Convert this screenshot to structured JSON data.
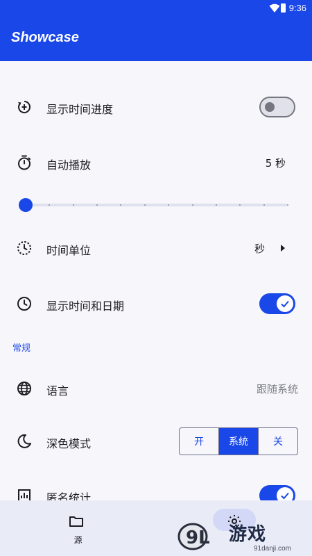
{
  "status": {
    "time": "9:36"
  },
  "appbar": {
    "title": "Showcase"
  },
  "rows": {
    "show_progress": {
      "label": "显示时间进度",
      "toggle": "off"
    },
    "autoplay": {
      "label": "自动播放",
      "value": "5 秒"
    },
    "slider": {
      "value_fraction": 0,
      "ticks": 12
    },
    "time_unit": {
      "label": "时间单位",
      "value": "秒"
    },
    "show_datetime": {
      "label": "显示时间和日期",
      "toggle": "on"
    }
  },
  "section": {
    "general": "常规"
  },
  "general": {
    "language": {
      "label": "语言",
      "value": "跟随系统"
    },
    "dark_mode": {
      "label": "深色模式",
      "options": [
        "开",
        "系统",
        "关"
      ],
      "selected": "系统"
    },
    "analytics": {
      "label": "匿名统计",
      "toggle": "on"
    }
  },
  "bottom_nav": {
    "items": [
      {
        "label": "源",
        "icon": "folder-icon"
      },
      {
        "label": "",
        "icon": "settings-icon"
      }
    ]
  },
  "watermark": {
    "text": "游戏",
    "brand": "9L",
    "url": "91danji.com"
  },
  "colors": {
    "primary": "#1a47e8",
    "background": "#f6f6fb",
    "nav": "#e9ebf7"
  }
}
